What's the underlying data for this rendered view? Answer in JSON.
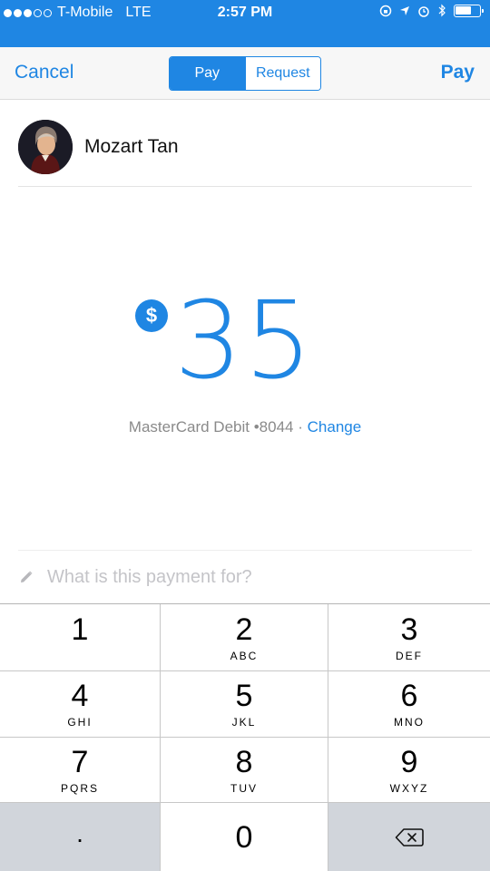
{
  "status_bar": {
    "carrier": "T-Mobile",
    "network": "LTE",
    "time": "2:57 PM"
  },
  "nav": {
    "cancel_label": "Cancel",
    "segments": [
      "Pay",
      "Request"
    ],
    "selected_segment": "Pay",
    "pay_label": "Pay"
  },
  "recipient": {
    "name": "Mozart Tan"
  },
  "amount": {
    "currency_symbol": "$",
    "value": "35"
  },
  "payment_method": {
    "card": "MasterCard Debit",
    "last4": "•8044",
    "separator": "·",
    "change_label": "Change"
  },
  "note": {
    "placeholder": "What is this payment for?"
  },
  "keypad": [
    {
      "digit": "1",
      "letters": ""
    },
    {
      "digit": "2",
      "letters": "ABC"
    },
    {
      "digit": "3",
      "letters": "DEF"
    },
    {
      "digit": "4",
      "letters": "GHI"
    },
    {
      "digit": "5",
      "letters": "JKL"
    },
    {
      "digit": "6",
      "letters": "MNO"
    },
    {
      "digit": "7",
      "letters": "PQRS"
    },
    {
      "digit": "8",
      "letters": "TUV"
    },
    {
      "digit": "9",
      "letters": "WXYZ"
    },
    {
      "digit": ".",
      "letters": ""
    },
    {
      "digit": "0",
      "letters": ""
    },
    {
      "digit": "",
      "letters": ""
    }
  ],
  "colors": {
    "accent": "#1f86e3",
    "muted_text": "#8a8a8a",
    "keypad_dark": "#d1d5db"
  },
  "icons": {
    "signal": "signal-dots-icon",
    "location": "location-arrow-icon",
    "alarm": "alarm-icon",
    "bluetooth": "bluetooth-icon",
    "battery": "battery-icon",
    "currency": "dollar-circle-icon",
    "pencil": "pencil-icon",
    "backspace": "backspace-icon"
  }
}
